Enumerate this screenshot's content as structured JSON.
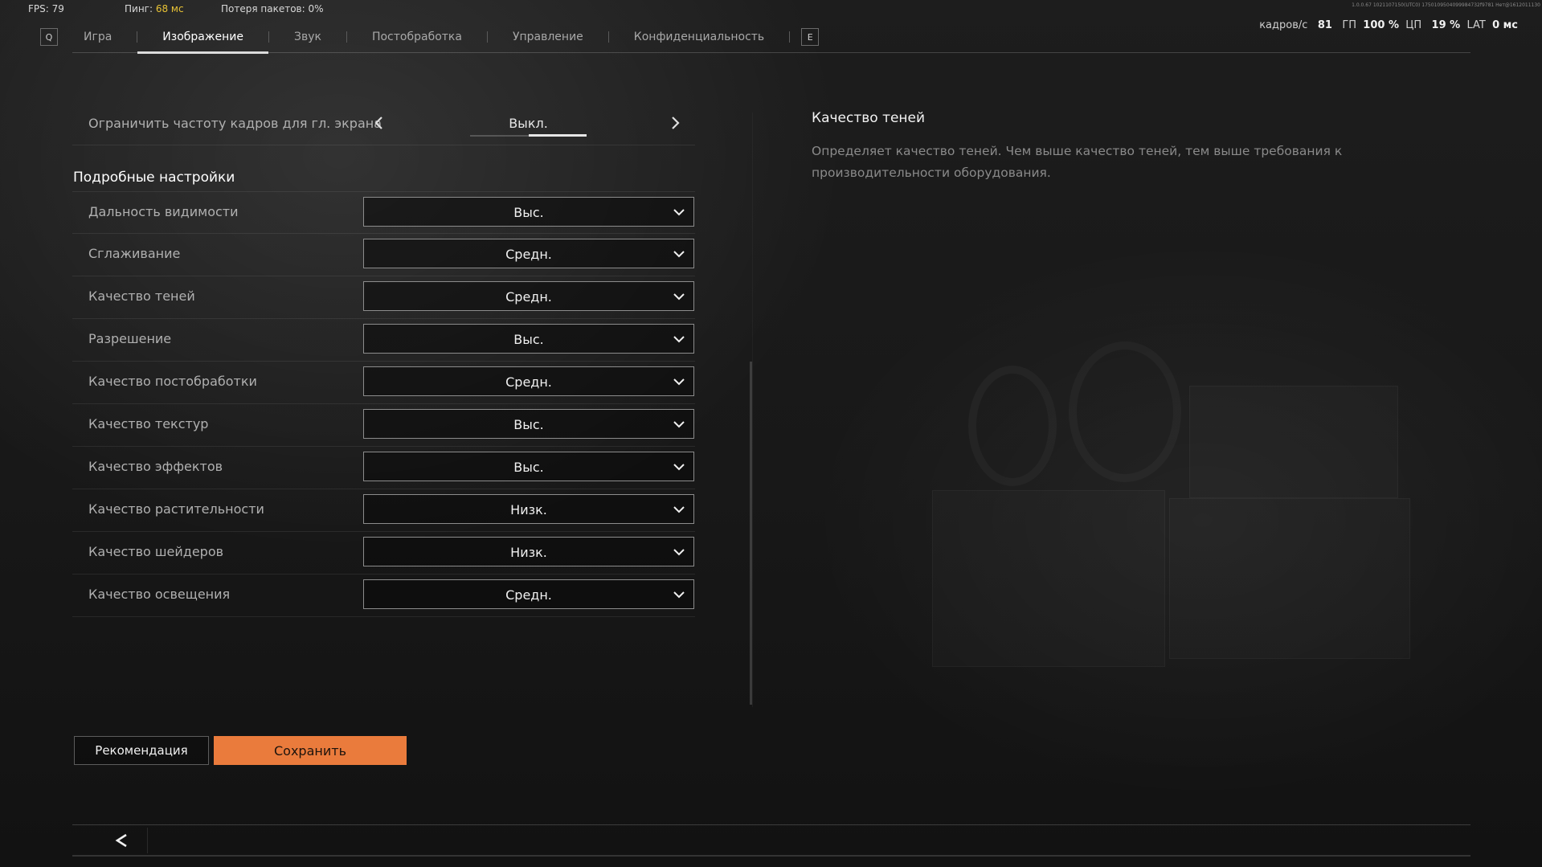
{
  "hud": {
    "fps_label": "FPS: 79",
    "ping_label": "Пинг:",
    "ping_value": "68 мс",
    "packet_loss": "Потеря пакетов: 0%",
    "stats_fps_label": "кадров/с",
    "stats_fps_value": "81",
    "stats_gpu_label": "ГП",
    "stats_gpu_value": "100 %",
    "stats_cpu_label": "ЦП",
    "stats_cpu_value": "19 %",
    "stats_lat_label": "LAT",
    "stats_lat_value": "0 мс",
    "build_info": "1.0.0.67 1021107150(UTC0) 1750109504099984732f9781 Нет@1612011130"
  },
  "tabs": {
    "prev_key": "Q",
    "next_key": "E",
    "items": [
      "Игра",
      "Изображение",
      "Звук",
      "Постобработка",
      "Управление",
      "Конфиденциальность"
    ],
    "active": "Изображение"
  },
  "fps_limit": {
    "label": "Ограничить частоту кадров для гл. экрана",
    "value": "Выкл."
  },
  "section_title": "Подробные настройки",
  "settings": [
    {
      "label": "Дальность видимости",
      "value": "Выс."
    },
    {
      "label": "Сглаживание",
      "value": "Средн."
    },
    {
      "label": "Качество теней",
      "value": "Средн."
    },
    {
      "label": "Разрешение",
      "value": "Выс."
    },
    {
      "label": "Качество постобработки",
      "value": "Средн."
    },
    {
      "label": "Качество текстур",
      "value": "Выс."
    },
    {
      "label": "Качество эффектов",
      "value": "Выс."
    },
    {
      "label": "Качество растительности",
      "value": "Низк."
    },
    {
      "label": "Качество шейдеров",
      "value": "Низк."
    },
    {
      "label": "Качество освещения",
      "value": "Средн."
    }
  ],
  "buttons": {
    "recommend": "Рекомендация",
    "save": "Сохранить"
  },
  "info": {
    "title": "Качество теней",
    "description": "Определяет качество теней. Чем выше качество теней, тем выше требования к производительности оборудования."
  },
  "colors": {
    "accent": "#ea7b3c",
    "ping": "#e9c335"
  }
}
